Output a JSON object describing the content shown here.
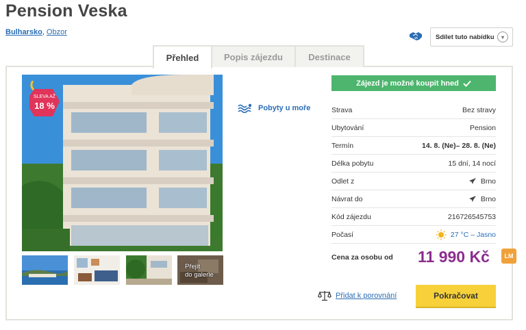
{
  "header": {
    "title": "Pension Veska"
  },
  "breadcrumb": {
    "country": "Bulharsko",
    "separator": ",",
    "place": "Obzor"
  },
  "share": {
    "label": "Sdílet tuto nabídku",
    "icon": "handshake-icon"
  },
  "tabs": [
    {
      "label": "Přehled",
      "active": true
    },
    {
      "label": "Popis zájezdu",
      "active": false
    },
    {
      "label": "Destinace",
      "active": false
    }
  ],
  "gallery": {
    "discount": {
      "line1": "SLEVA AŽ",
      "value": "18 %"
    },
    "more_label_line1": "Přejít",
    "more_label_line2": "do galerie"
  },
  "feature": {
    "label": "Pobyty u moře",
    "icon": "beach-waves-icon"
  },
  "availability": {
    "label": "Zájezd je možné koupit hned",
    "icon": "check-icon",
    "color": "#4db56d"
  },
  "details": [
    {
      "label": "Strava",
      "value": "Bez stravy",
      "bold": false,
      "icon": ""
    },
    {
      "label": "Ubytování",
      "value": "Pension",
      "bold": false,
      "icon": ""
    },
    {
      "label": "Termín",
      "value": "14. 8. (Ne)– 28. 8. (Ne)",
      "bold": true,
      "icon": ""
    },
    {
      "label": "Délka pobytu",
      "value": "15 dní, 14 nocí",
      "bold": false,
      "icon": ""
    },
    {
      "label": "Odlet z",
      "value": "Brno",
      "bold": false,
      "icon": "plane-icon"
    },
    {
      "label": "Návrat do",
      "value": "Brno",
      "bold": false,
      "icon": "plane-icon"
    },
    {
      "label": "Kód zájezdu",
      "value": "216726545753",
      "bold": false,
      "icon": ""
    },
    {
      "label": "Počasí",
      "value": "27 °C – Jasno",
      "bold": false,
      "icon": "sun-icon"
    }
  ],
  "price": {
    "label": "Cena za osobu od",
    "value": "11 990 Kč",
    "badge": "LM",
    "color": "#8b2d8f"
  },
  "actions": {
    "compare_label": "Přidat k porovnání",
    "continue_label": "Pokračovat"
  }
}
